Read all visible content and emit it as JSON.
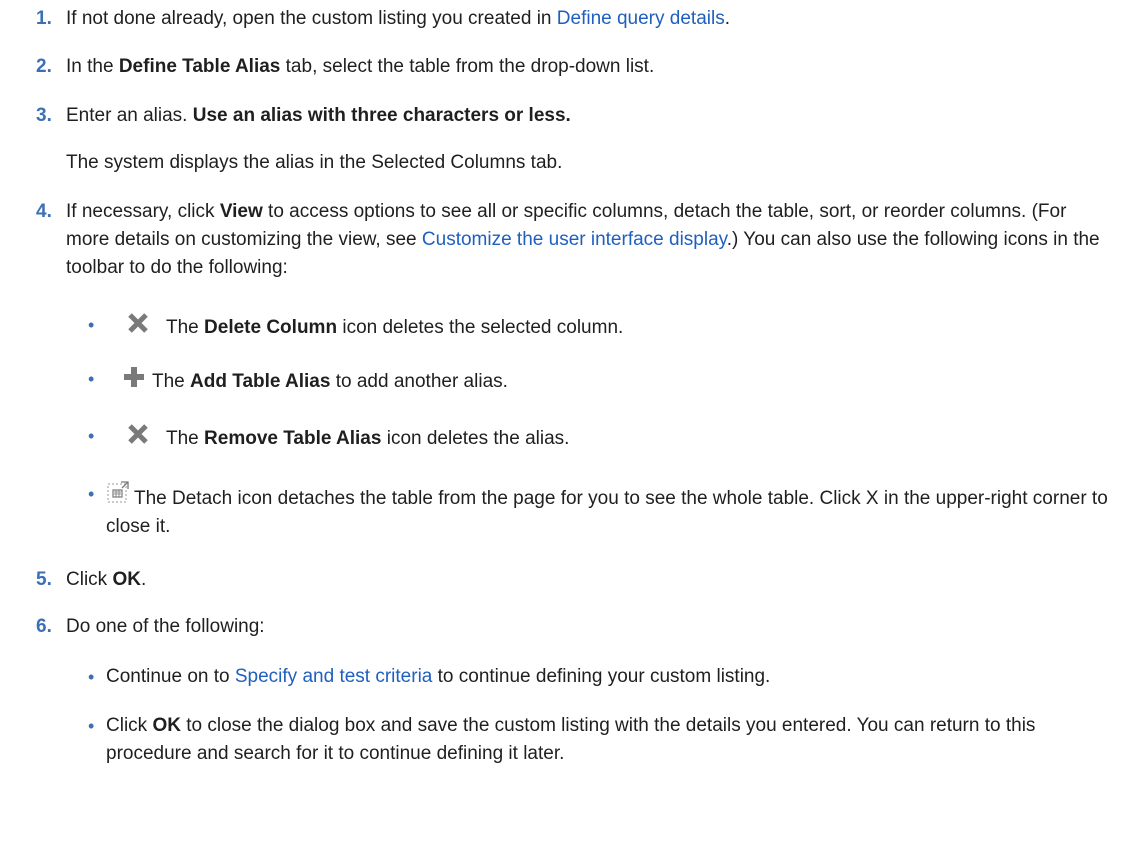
{
  "steps": [
    {
      "num": "1.",
      "pre": "If not done already, open the custom listing you created in ",
      "link": "Define query details",
      "post": "."
    },
    {
      "num": "2.",
      "pre": "In the ",
      "bold": "Define Table Alias",
      "post": " tab, select the table from the drop-down list."
    },
    {
      "num": "3.",
      "pre": "Enter an alias. ",
      "bold": "Use an alias with three characters or less.",
      "note": "The system displays the alias in the Selected Columns tab."
    },
    {
      "num": "4.",
      "pre": "If necessary, click ",
      "bold": "View",
      "mid": " to access options to see all or specific columns, detach the table, sort, or reorder columns. (For more details on customizing the view, see ",
      "link": "Customize the user interface display",
      "post": ".) You can also use the following icons in the toolbar to do the following:",
      "bullets": [
        {
          "icon": "close-x-icon",
          "pre": "The ",
          "bold": "Delete Column",
          "post": " icon deletes the selected column."
        },
        {
          "icon": "plus-icon",
          "pre": "The ",
          "bold": "Add Table Alias",
          "post": " to add another alias."
        },
        {
          "icon": "close-x-icon",
          "pre": "The ",
          "bold": "Remove Table Alias",
          "post": " icon deletes the alias."
        },
        {
          "icon": "detach-icon",
          "pre": "The Detach icon detaches the table from the page for you to see the whole table. Click X in the upper-right corner to close it."
        }
      ]
    },
    {
      "num": "5.",
      "pre": "Click ",
      "bold": "OK",
      "post": "."
    },
    {
      "num": "6.",
      "pre": "Do one of the following:",
      "bullets": [
        {
          "pre": "Continue on to ",
          "link": "Specify and test criteria",
          "post": " to continue defining your custom listing."
        },
        {
          "pre": "Click ",
          "bold": "OK",
          "post": " to close the dialog box and save the custom listing with the details you entered. You can return to this procedure and search for it to continue defining it later."
        }
      ]
    }
  ],
  "colors": {
    "number": "#3b6fb6",
    "link": "#1f5fbf",
    "text": "#1f1f1f",
    "icon": "#7a7a7a"
  }
}
